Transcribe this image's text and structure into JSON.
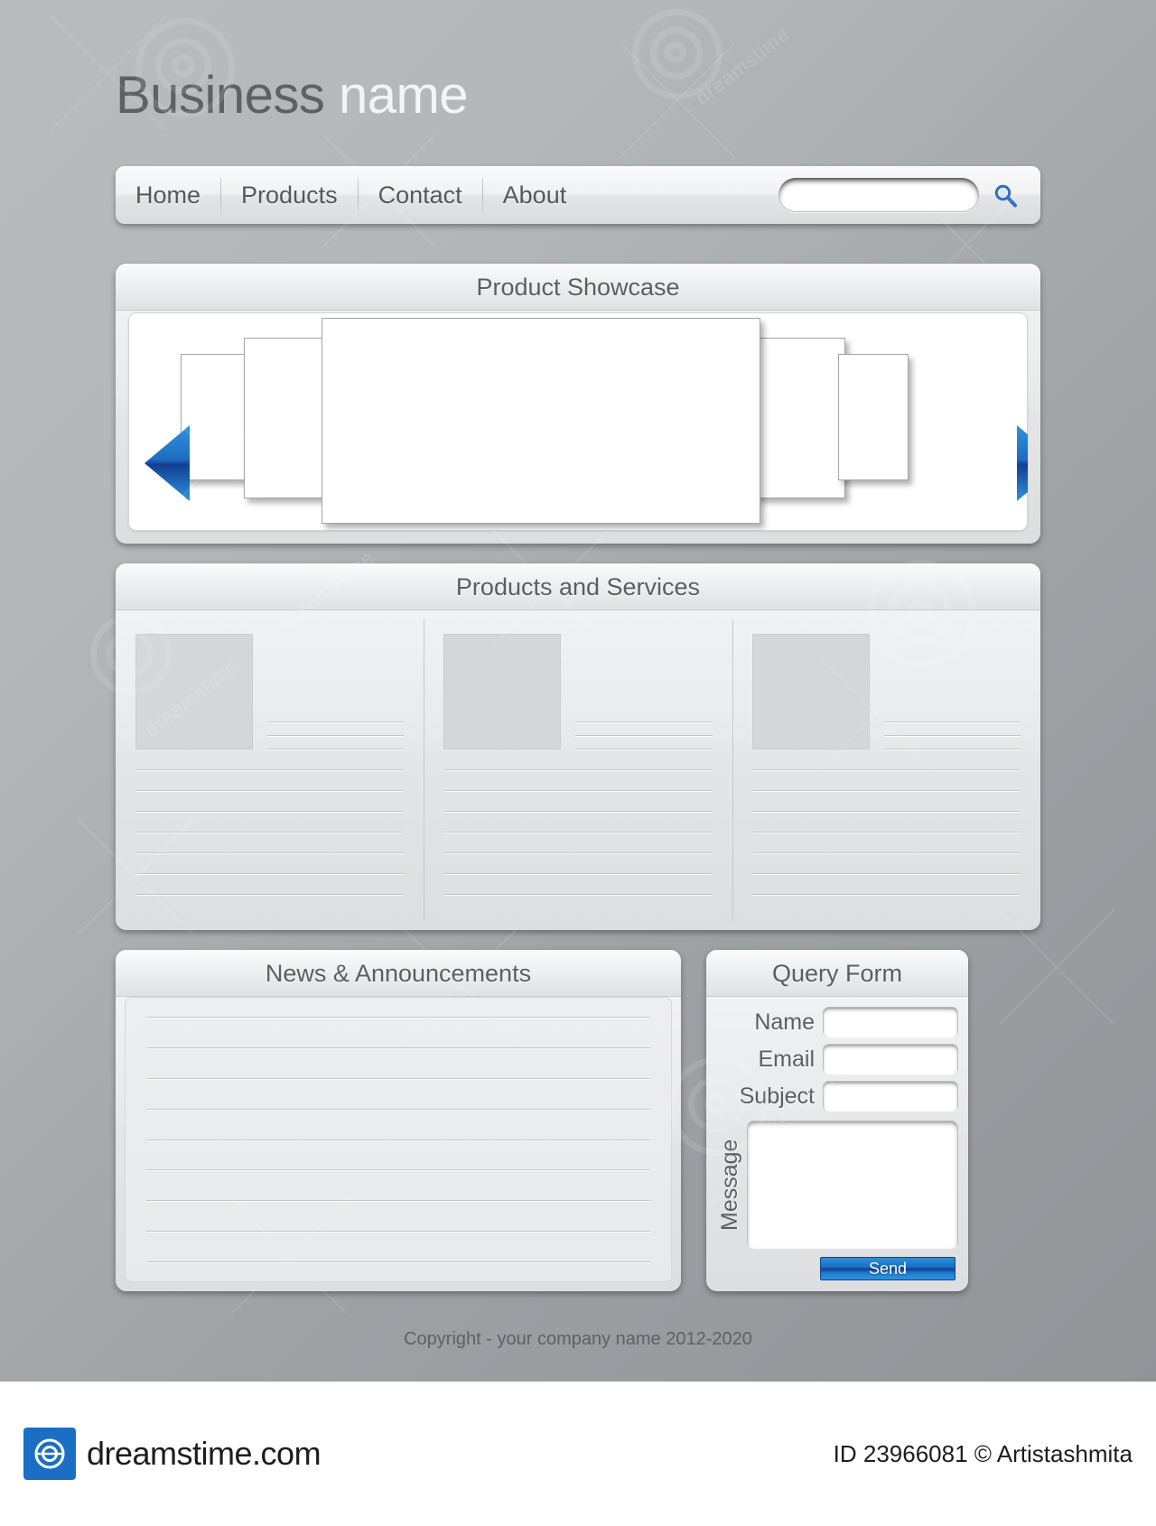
{
  "site": {
    "title_part1": "Business",
    "title_part2": "name"
  },
  "nav": {
    "items": [
      {
        "label": "Home"
      },
      {
        "label": "Products"
      },
      {
        "label": "Contact"
      },
      {
        "label": "About"
      }
    ],
    "search": {
      "value": "",
      "placeholder": "",
      "icon": "search-icon"
    }
  },
  "showcase": {
    "heading": "Product Showcase",
    "prev_icon": "arrow-left-icon",
    "next_icon": "arrow-right-icon",
    "slides": [
      "",
      "",
      "",
      "",
      ""
    ]
  },
  "products_services": {
    "heading": "Products and Services",
    "columns": [
      {
        "image_placeholder": "",
        "text_lines": 3,
        "body_lines": 7
      },
      {
        "image_placeholder": "",
        "text_lines": 3,
        "body_lines": 7
      },
      {
        "image_placeholder": "",
        "text_lines": 3,
        "body_lines": 7
      }
    ]
  },
  "news": {
    "heading": "News & Announcements",
    "lines": 9
  },
  "query_form": {
    "heading": "Query Form",
    "fields": [
      {
        "label": "Name",
        "value": "",
        "placeholder": ""
      },
      {
        "label": "Email",
        "value": "",
        "placeholder": ""
      },
      {
        "label": "Subject",
        "value": "",
        "placeholder": ""
      }
    ],
    "message": {
      "label": "Message",
      "value": "",
      "placeholder": ""
    },
    "submit_label": "Send"
  },
  "footer": {
    "copyright": "Copyright - your company name 2012-2020"
  },
  "stock_bar": {
    "site_name": "dreamstime.com",
    "credit": "ID 23966081 © Artistashmita"
  },
  "colors": {
    "accent_blue": "#1a6fc4",
    "arrow_blue_light": "#2f93dd",
    "arrow_blue_dark": "#123f95",
    "panel_bg": "#e9eaec",
    "text_dark": "#5b5e61",
    "page_bg": "#a8abae"
  }
}
